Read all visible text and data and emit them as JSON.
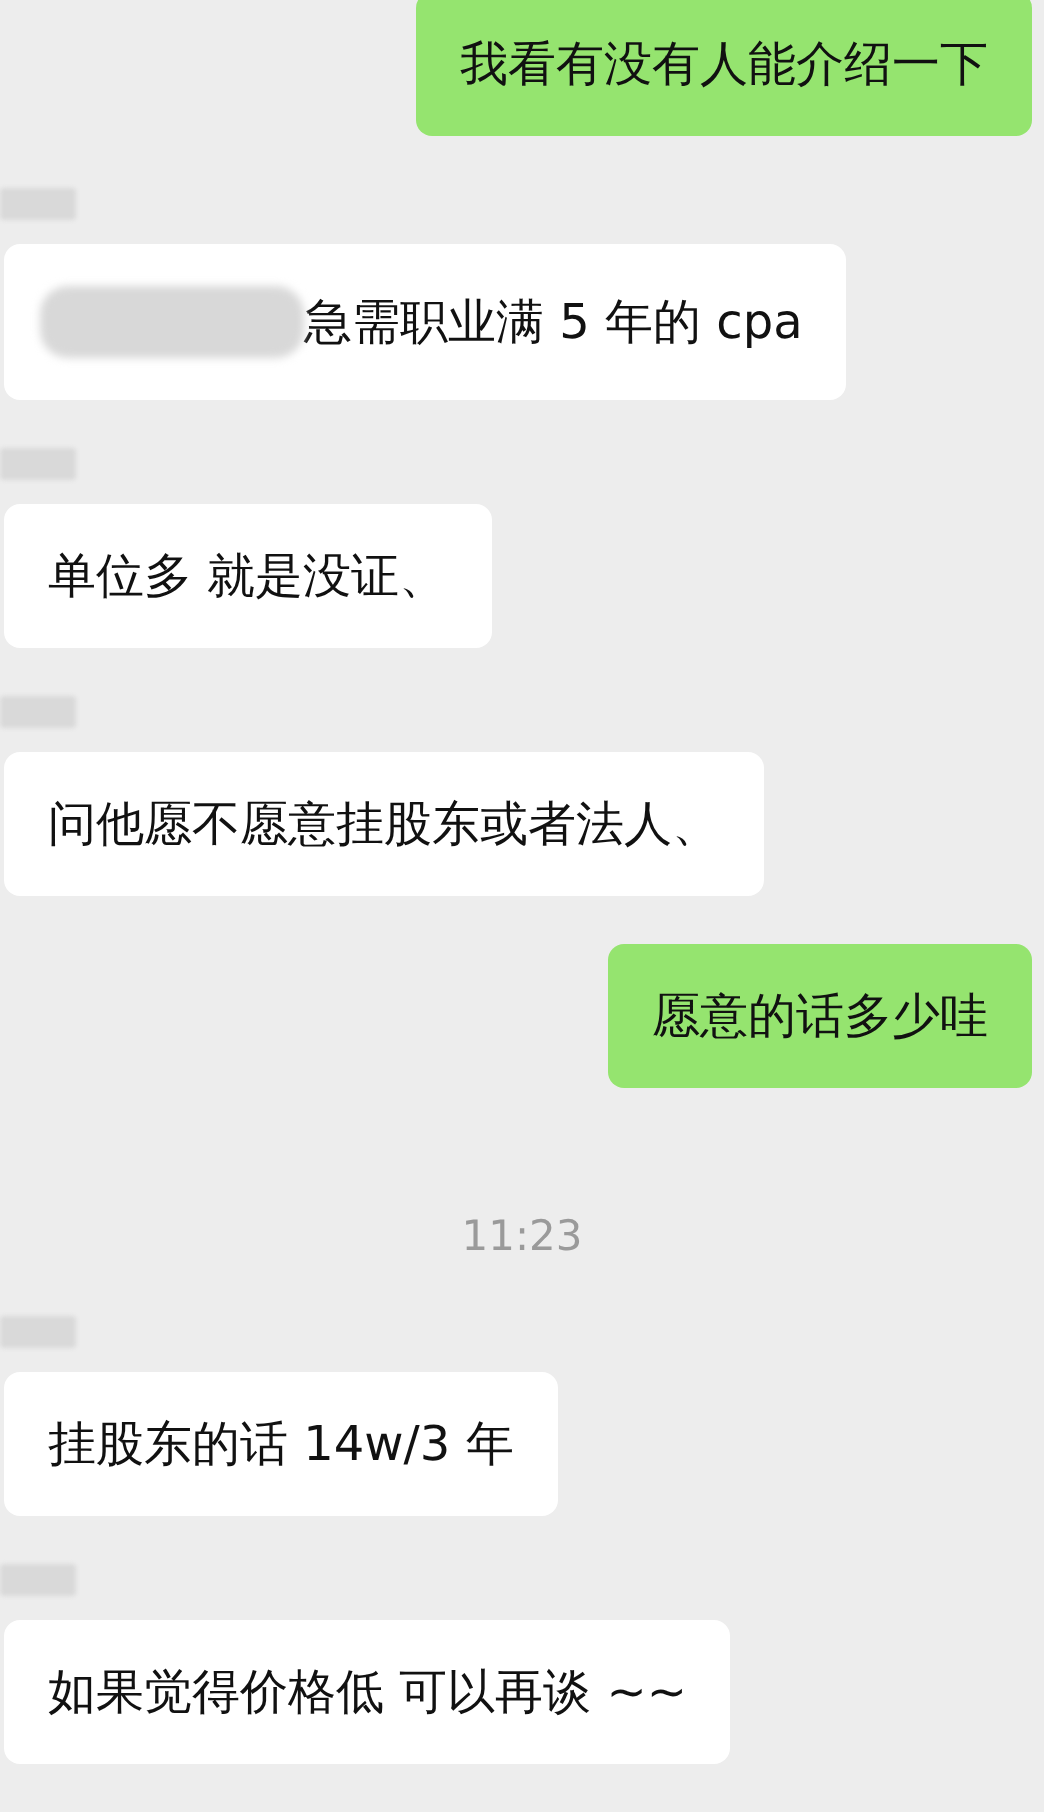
{
  "messages": [
    {
      "kind": "sent",
      "text": "我看有没有人能介绍一下"
    },
    {
      "kind": "received",
      "redacted": true,
      "text": "急需职业满 5 年的 cpa"
    },
    {
      "kind": "received",
      "redacted": false,
      "text": "单位多 就是没证、"
    },
    {
      "kind": "received",
      "redacted": false,
      "text": "问他愿不愿意挂股东或者法人、"
    },
    {
      "kind": "sent",
      "text": "愿意的话多少哇"
    },
    {
      "kind": "time",
      "text": "11:23"
    },
    {
      "kind": "received",
      "redacted": false,
      "text": "挂股东的话 14w/3 年"
    },
    {
      "kind": "received",
      "redacted": false,
      "text": "如果觉得价格低 可以再谈 ~~"
    }
  ]
}
